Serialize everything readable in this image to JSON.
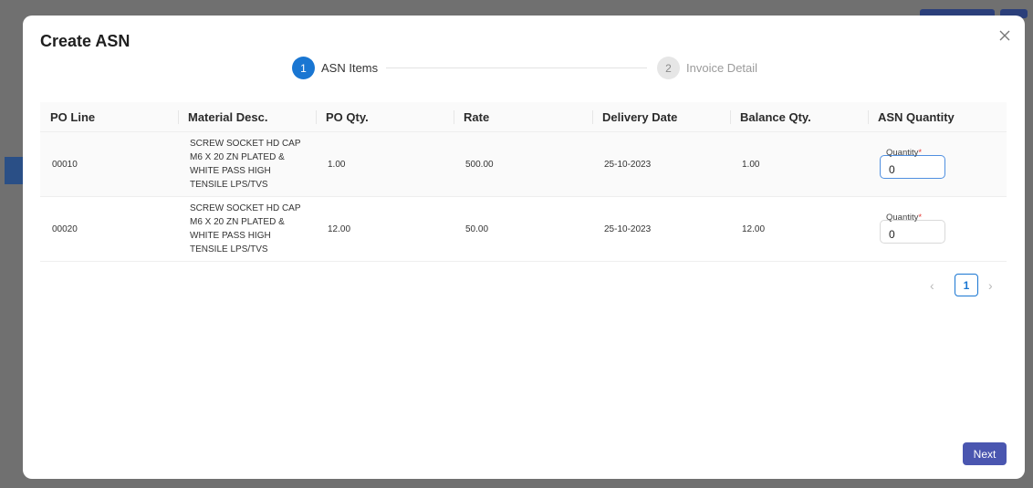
{
  "modal": {
    "title": "Create ASN",
    "next_label": "Next"
  },
  "stepper": [
    {
      "number": "1",
      "label": "ASN Items",
      "active": true
    },
    {
      "number": "2",
      "label": "Invoice Detail",
      "active": false
    }
  ],
  "table": {
    "columns": [
      "PO Line",
      "Material Desc.",
      "PO Qty.",
      "Rate",
      "Delivery Date",
      "Balance Qty.",
      "ASN Quantity"
    ],
    "rows": [
      {
        "po_line": "00010",
        "material_desc": "SCREW SOCKET HD CAP M6 X 20 ZN PLATED & WHITE PASS HIGH TENSILE LPS/TVS",
        "po_qty": "1.00",
        "rate": "500.00",
        "delivery_date": "25-10-2023",
        "balance_qty": "1.00",
        "asn_quantity": {
          "label": "Quantity",
          "required_mark": "*",
          "value": "0"
        }
      },
      {
        "po_line": "00020",
        "material_desc": "SCREW SOCKET HD CAP M6 X 20 ZN PLATED & WHITE PASS HIGH TENSILE LPS/TVS",
        "po_qty": "12.00",
        "rate": "50.00",
        "delivery_date": "25-10-2023",
        "balance_qty": "12.00",
        "asn_quantity": {
          "label": "Quantity",
          "required_mark": "*",
          "value": "0"
        }
      }
    ]
  },
  "pagination": {
    "current_page": "1",
    "prev_icon": "chevron-left-icon",
    "next_icon": "chevron-right-icon"
  },
  "colors": {
    "primary": "#1976d2",
    "next_button": "#4a56b0",
    "required": "#e53935"
  }
}
